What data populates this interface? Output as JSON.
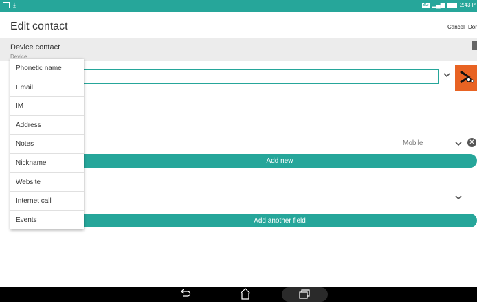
{
  "status_bar": {
    "time": "2:43 P",
    "network": "3G"
  },
  "header": {
    "title": "Edit contact",
    "cancel": "Cancel",
    "done": "Dor"
  },
  "account": {
    "name": "Device contact",
    "type": "Device"
  },
  "phone": {
    "type": "Mobile"
  },
  "buttons": {
    "add_new": "Add new",
    "add_field": "Add another field"
  },
  "menu": {
    "items": [
      "Phonetic name",
      "Email",
      "IM",
      "Address",
      "Notes",
      "Nickname",
      "Website",
      "Internet call",
      "Events"
    ]
  },
  "colors": {
    "accent": "#26a69a",
    "photo": "#e86323",
    "navbar": "#000000"
  },
  "icons": [
    "notification-icon",
    "download-icon",
    "signal-icon",
    "battery-icon",
    "chevron-down-icon",
    "close-icon",
    "back-icon",
    "home-icon",
    "recent-apps-icon"
  ]
}
